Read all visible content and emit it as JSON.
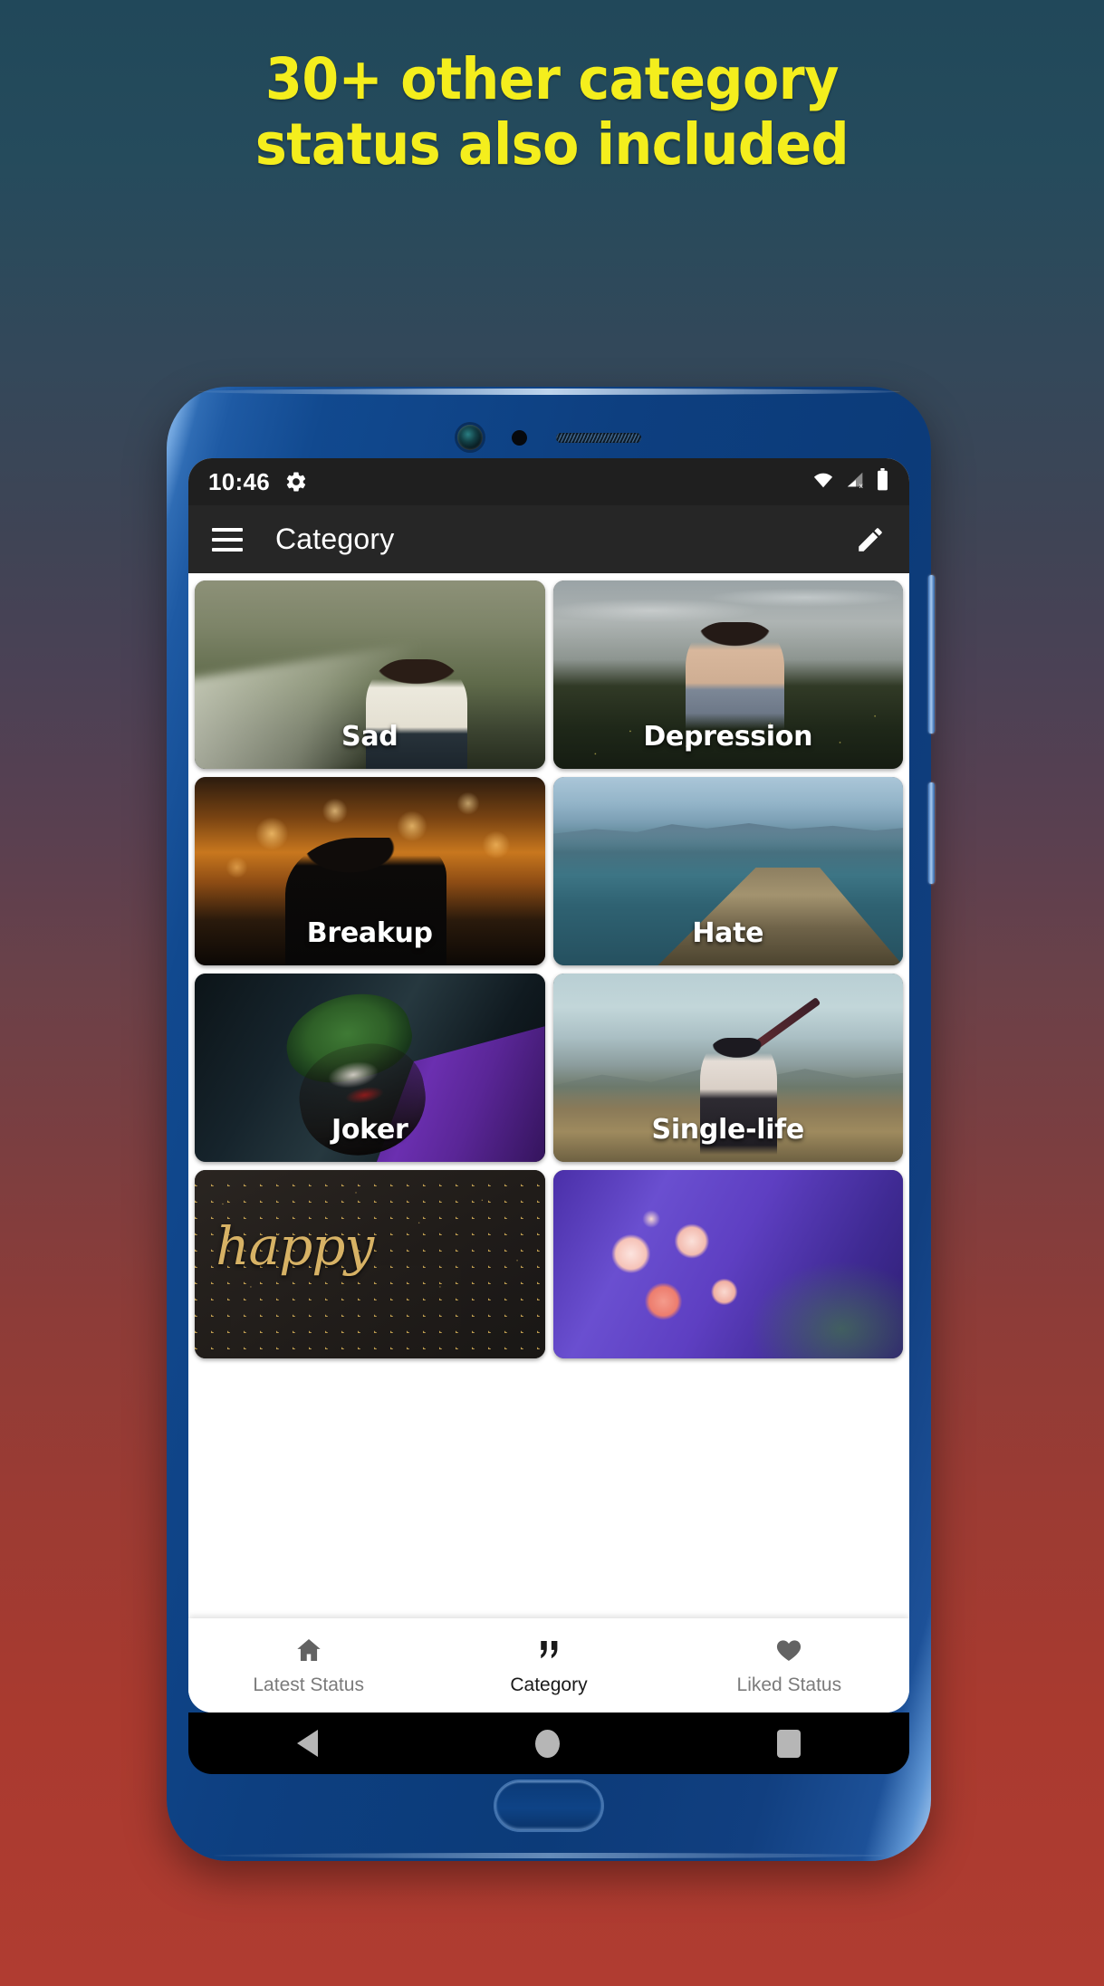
{
  "promo": {
    "line1": "30+ other category",
    "line2": "status also included",
    "text_color": "#f4ee1d"
  },
  "background": {
    "top_color": "#21485a",
    "bottom_color": "#a93a2f"
  },
  "phone": {
    "body_color": "#0c3b79",
    "icons": {
      "camera": "camera-lens",
      "proximity": "proximity-sensor",
      "earpiece": "earpiece-grille",
      "home_button": "home-button",
      "volume": "volume-rocker",
      "power": "power-button"
    }
  },
  "status_bar": {
    "time": "10:46",
    "gear_icon": "gear-icon",
    "wifi_icon": "wifi-icon",
    "signal_icon": "signal-no-sim-icon",
    "battery_icon": "battery-full-icon"
  },
  "app_bar": {
    "menu_icon": "hamburger-menu-icon",
    "title": "Category",
    "action_icon": "edit-pencil-icon"
  },
  "categories": [
    {
      "label": "Sad",
      "art": "art-sad"
    },
    {
      "label": "Depression",
      "art": "art-dep"
    },
    {
      "label": "Breakup",
      "art": "art-brk"
    },
    {
      "label": "Hate",
      "art": "art-hate"
    },
    {
      "label": "Joker",
      "art": "art-joker"
    },
    {
      "label": "Single-life",
      "art": "art-single"
    },
    {
      "label": "",
      "art": "art-happy",
      "overlay_text": "happy"
    },
    {
      "label": "",
      "art": "art-flower"
    }
  ],
  "bottom_nav": {
    "items": [
      {
        "label": "Latest Status",
        "icon": "home-icon",
        "active": false
      },
      {
        "label": "Category",
        "icon": "quote-icon",
        "active": true
      },
      {
        "label": "Liked Status",
        "icon": "heart-icon",
        "active": false
      }
    ]
  },
  "android_nav": {
    "back": "back-triangle-icon",
    "home": "home-circle-icon",
    "recents": "recents-square-icon"
  }
}
